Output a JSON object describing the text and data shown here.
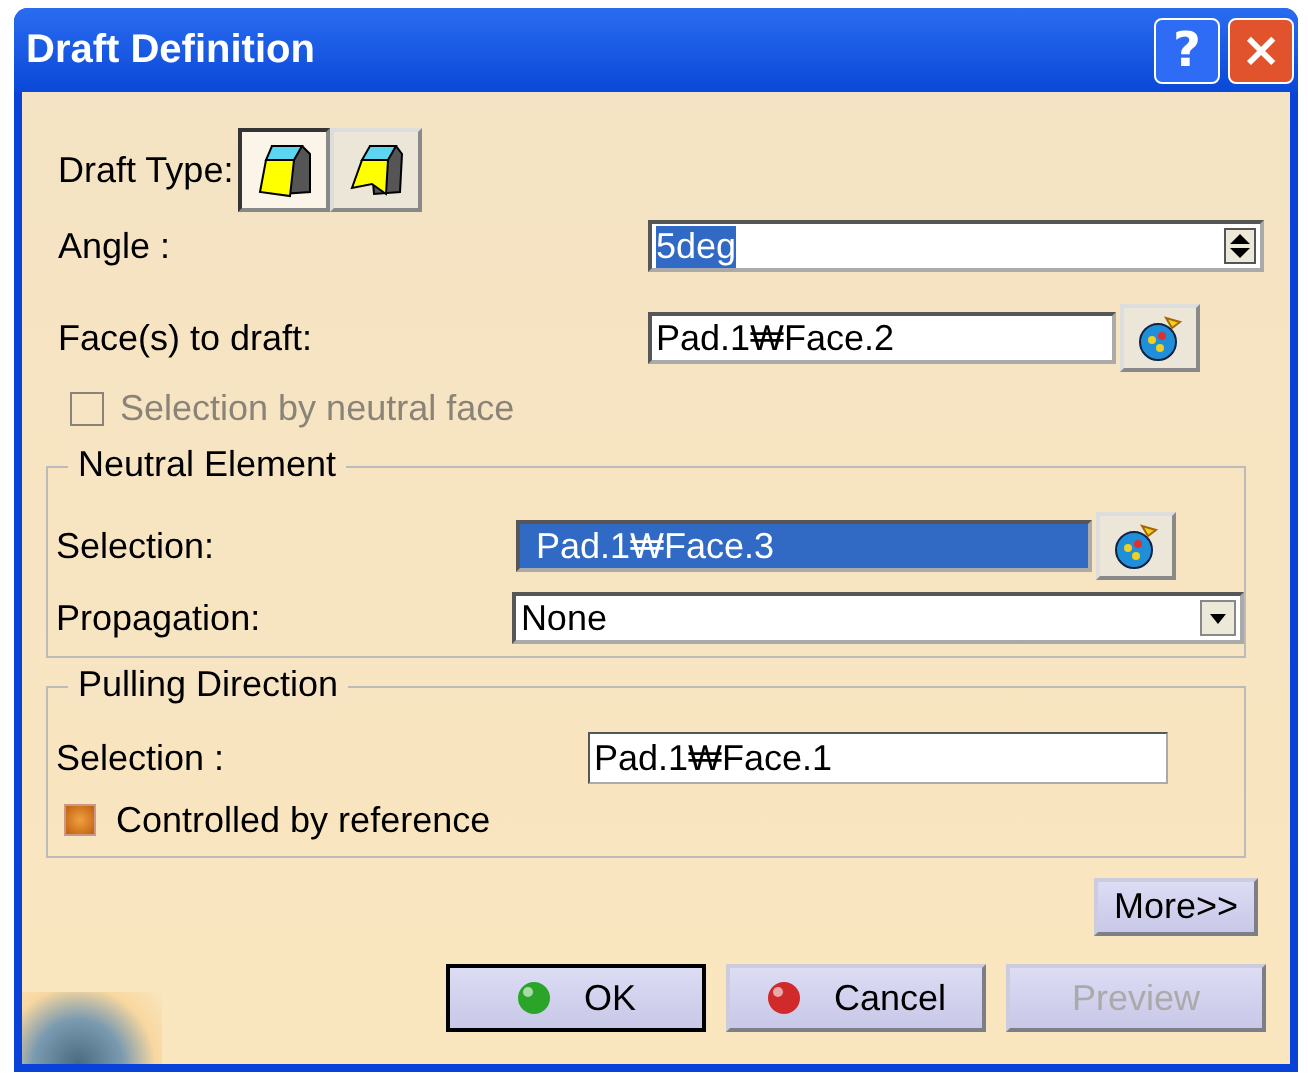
{
  "window": {
    "title": "Draft Definition",
    "help_button": "?",
    "close_button": "×"
  },
  "draft_type": {
    "label": "Draft Type:",
    "options": [
      {
        "kind": "constant",
        "selected": true
      },
      {
        "kind": "variable",
        "selected": false
      }
    ]
  },
  "angle": {
    "label": "Angle :",
    "value": "5deg",
    "highlighted": true
  },
  "faces": {
    "label": "Face(s) to draft:",
    "value": "Pad.1₩Face.2"
  },
  "neutral_face": {
    "label": "Selection by neutral face",
    "checked": false,
    "disabled": true
  },
  "neutral_element": {
    "title": "Neutral Element",
    "selection": {
      "label": "Selection:",
      "value": "Pad.1₩Face.3",
      "highlighted": true
    },
    "propagation": {
      "label": "Propagation:",
      "value": "None"
    }
  },
  "pulling_direction": {
    "title": "Pulling Direction",
    "selection": {
      "label": "Selection :",
      "value": "Pad.1₩Face.1"
    },
    "controlled": {
      "label": "Controlled by reference",
      "checked": true
    }
  },
  "more_button": {
    "label": "More>>"
  },
  "buttons": [
    {
      "kind": "ok",
      "label": "OK",
      "default": true,
      "disabled": false
    },
    {
      "kind": "cancel",
      "label": "Cancel",
      "default": false,
      "disabled": false
    },
    {
      "kind": "preview",
      "label": "Preview",
      "default": false,
      "disabled": true
    }
  ]
}
